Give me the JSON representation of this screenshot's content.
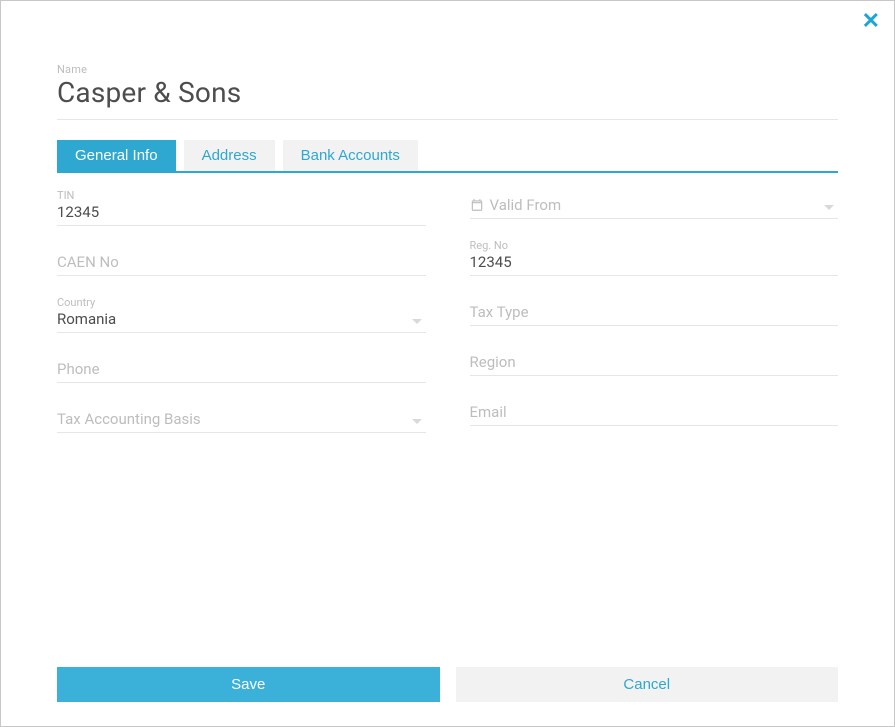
{
  "name_label": "Name",
  "name_value": "Casper & Sons",
  "tabs": {
    "general": "General Info",
    "address": "Address",
    "bank": "Bank Accounts"
  },
  "left": {
    "tin_label": "TIN",
    "tin_value": "12345",
    "caen_placeholder": "CAEN No",
    "country_label": "Country",
    "country_value": "Romania",
    "phone_placeholder": "Phone",
    "tax_basis_placeholder": "Tax Accounting Basis"
  },
  "right": {
    "valid_from_placeholder": "Valid From",
    "regno_label": "Reg. No",
    "regno_value": "12345",
    "tax_type_placeholder": "Tax Type",
    "region_placeholder": "Region",
    "email_placeholder": "Email"
  },
  "buttons": {
    "save": "Save",
    "cancel": "Cancel"
  }
}
